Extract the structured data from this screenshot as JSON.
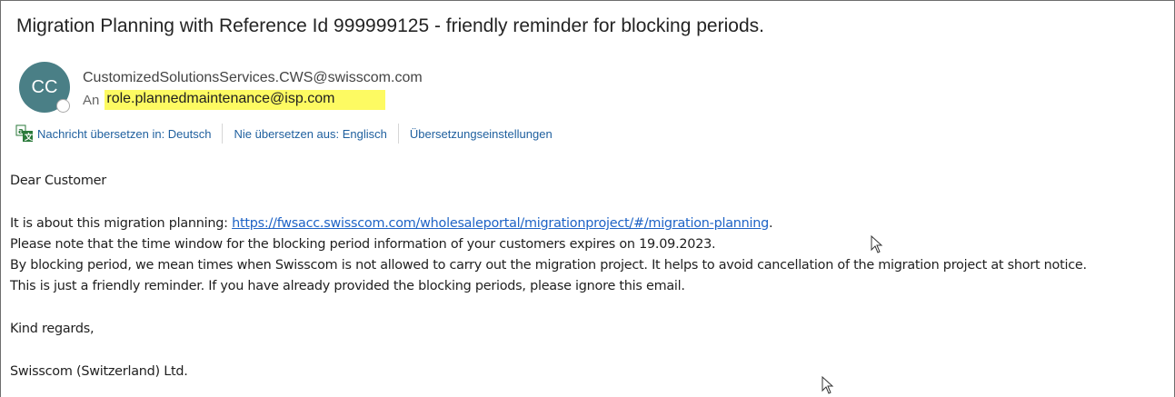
{
  "email": {
    "subject": "Migration Planning with Reference Id 999999125 - friendly reminder for blocking periods.",
    "avatar_initials": "CC",
    "sender": "CustomizedSolutionsServices.CWS@swisscom.com",
    "to_label": "An",
    "to_address": "role.plannedmaintenance@isp.com"
  },
  "translate": {
    "icon": "translate-icon",
    "translate_link": "Nachricht übersetzen in: Deutsch",
    "never_link": "Nie übersetzen aus: Englisch",
    "settings_link": "Übersetzungseinstellungen"
  },
  "body": {
    "greeting": "Dear Customer",
    "line1_prefix": "It is about this migration planning: ",
    "line1_link": "https://fwsacc.swisscom.com/wholesaleportal/migrationproject/#/migration-planning",
    "line1_suffix": ".",
    "line2": "Please note that the time window for the blocking period information of your customers expires on 19.09.2023.",
    "line3": "By blocking period, we mean times when Swisscom is not allowed to carry out the migration project. It helps to avoid cancellation of the migration project at short notice.",
    "line4": "This is just a friendly reminder. If you have already provided the blocking periods, please ignore this email.",
    "closing": "Kind regards,",
    "signature": "Swisscom (Switzerland) Ltd."
  },
  "colors": {
    "highlight": "#fdfa62",
    "avatar": "#4a7f86",
    "link": "#1e63c6",
    "translate_link": "#1e5f9e"
  }
}
